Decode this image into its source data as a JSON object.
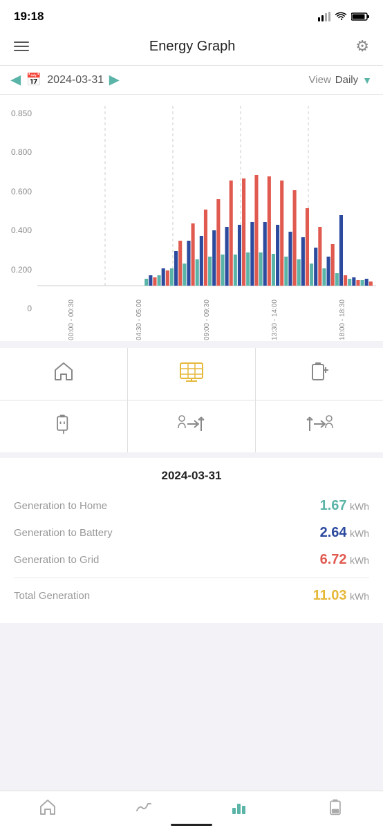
{
  "statusBar": {
    "time": "19:18",
    "battery": 80
  },
  "header": {
    "title": "Energy Graph",
    "menuLabel": "menu",
    "settingsLabel": "settings"
  },
  "dateNav": {
    "date": "2024-03-31",
    "viewLabel": "View",
    "viewValue": "Daily"
  },
  "chart": {
    "yLabels": [
      "0.850",
      "0.800",
      "0.600",
      "0.400",
      "0.200",
      "0"
    ],
    "xLabels": [
      "00:00 - 00:30",
      "04:30 - 05:00",
      "09:00 - 09:30",
      "13:30 - 14:00",
      "18:00 - 18:30"
    ],
    "colors": {
      "teal": "#5bb4a8",
      "navy": "#2c4a9e",
      "red": "#e05a50"
    }
  },
  "iconGrid": {
    "row1": [
      {
        "name": "home-icon",
        "symbol": "🏠",
        "active": false
      },
      {
        "name": "solar-panel-icon",
        "symbol": "⊞",
        "active": true
      },
      {
        "name": "battery-plus-icon",
        "symbol": "🔋",
        "active": false
      }
    ],
    "row2": [
      {
        "name": "plug-icon",
        "symbol": "🔌",
        "active": false
      },
      {
        "name": "export-grid-icon",
        "symbol": "⇒",
        "active": false
      },
      {
        "name": "import-grid-icon",
        "symbol": "⇐",
        "active": false
      }
    ]
  },
  "stats": {
    "date": "2024-03-31",
    "rows": [
      {
        "label": "Generation to Home",
        "value": "1.67",
        "unit": "kWh",
        "colorClass": "color-teal"
      },
      {
        "label": "Generation to Battery",
        "value": "2.64",
        "unit": "kWh",
        "colorClass": "color-navy"
      },
      {
        "label": "Generation to Grid",
        "value": "6.72",
        "unit": "kWh",
        "colorClass": "color-red"
      },
      {
        "label": "Total Generation",
        "value": "11.03",
        "unit": "kWh",
        "colorClass": "color-yellow"
      }
    ]
  },
  "bottomNav": {
    "items": [
      {
        "name": "nav-home",
        "symbol": "⌂",
        "active": false
      },
      {
        "name": "nav-trends",
        "symbol": "∿",
        "active": false
      },
      {
        "name": "nav-graph",
        "symbol": "▋",
        "active": true
      },
      {
        "name": "nav-battery",
        "symbol": "▮",
        "active": false
      }
    ]
  }
}
